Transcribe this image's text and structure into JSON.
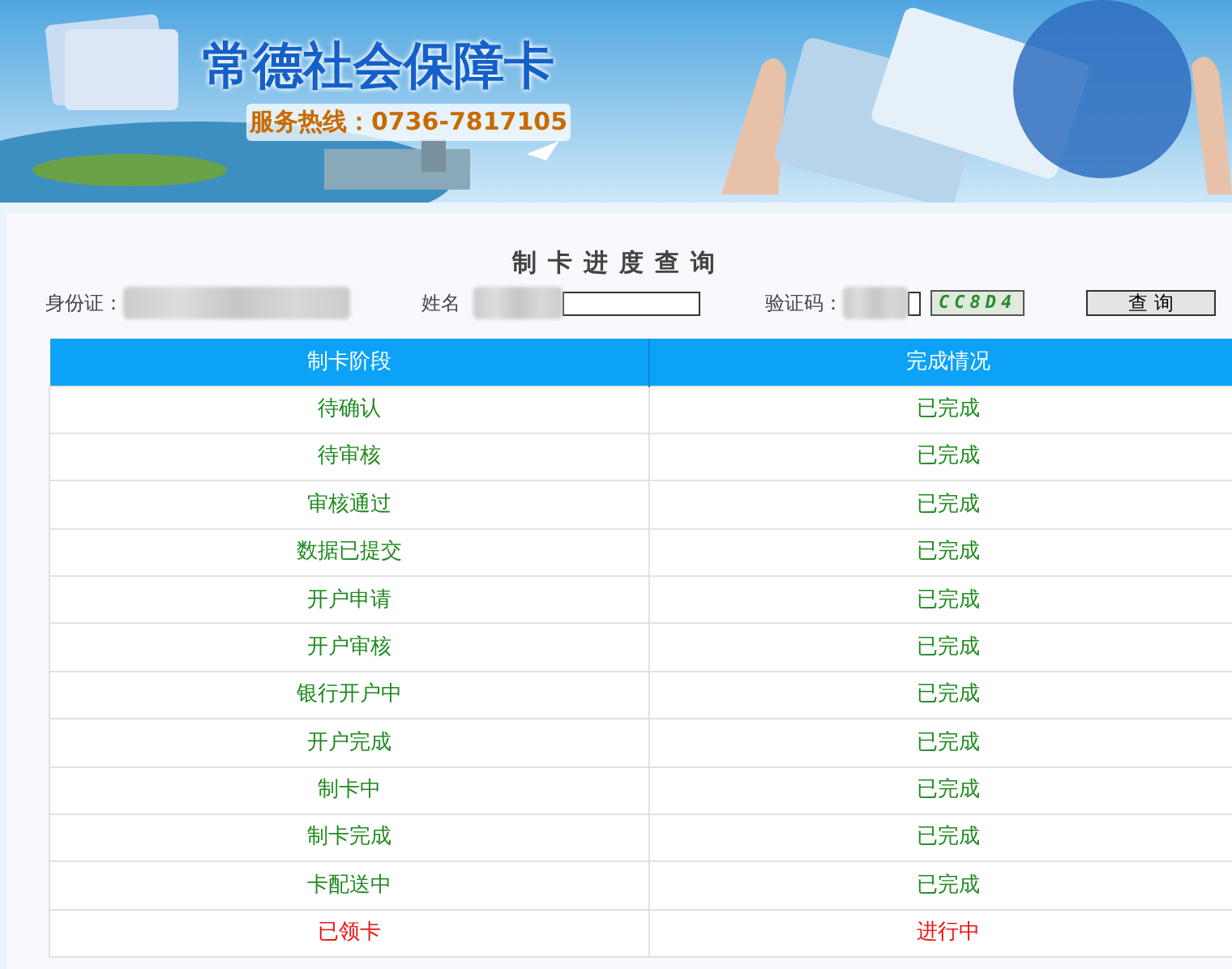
{
  "banner": {
    "title": "常德社会保障卡",
    "hotline": "服务热线：0736-7817105"
  },
  "query": {
    "title": "制卡进度查询",
    "id_label": "身份证：",
    "name_label": "姓名",
    "captcha_label": "验证码：",
    "captcha": "CC8D4",
    "button": "查 询"
  },
  "table": {
    "columns": [
      "制卡阶段",
      "完成情况"
    ],
    "rows": [
      {
        "stage": "待确认",
        "status": "已完成",
        "kind": "done"
      },
      {
        "stage": "待审核",
        "status": "已完成",
        "kind": "done"
      },
      {
        "stage": "审核通过",
        "status": "已完成",
        "kind": "done"
      },
      {
        "stage": "数据已提交",
        "status": "已完成",
        "kind": "done"
      },
      {
        "stage": "开户申请",
        "status": "已完成",
        "kind": "done"
      },
      {
        "stage": "开户审核",
        "status": "已完成",
        "kind": "done"
      },
      {
        "stage": "银行开户中",
        "status": "已完成",
        "kind": "done"
      },
      {
        "stage": "开户完成",
        "status": "已完成",
        "kind": "done"
      },
      {
        "stage": "制卡中",
        "status": "已完成",
        "kind": "done"
      },
      {
        "stage": "制卡完成",
        "status": "已完成",
        "kind": "done"
      },
      {
        "stage": "卡配送中",
        "status": "已完成",
        "kind": "done"
      },
      {
        "stage": "已领卡",
        "status": "进行中",
        "kind": "current"
      }
    ]
  }
}
